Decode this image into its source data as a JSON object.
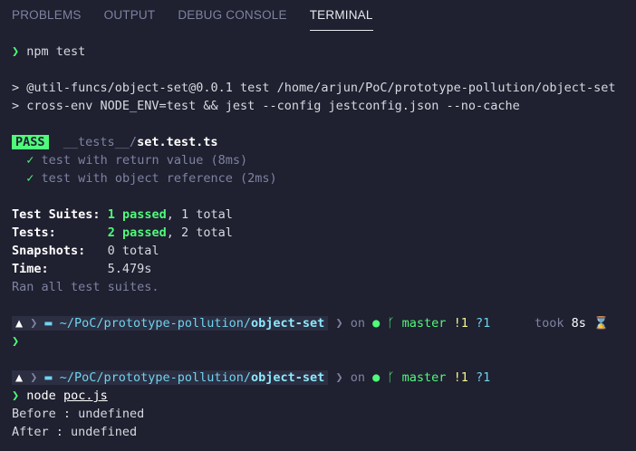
{
  "tabs": [
    "PROBLEMS",
    "OUTPUT",
    "DEBUG CONSOLE",
    "TERMINAL"
  ],
  "terminal": {
    "prompt_symbol": "❯",
    "cmd1": "npm test",
    "script_line1": "> @util-funcs/object-set@0.0.1 test /home/arjun/PoC/prototype-pollution/object-set",
    "script_line2": "> cross-env NODE_ENV=test && jest --config jestconfig.json --no-cache",
    "pass_badge": "PASS",
    "test_dir": "__tests__/",
    "test_file": "set.test.ts",
    "check": "✓",
    "test1": "test with return value (8ms)",
    "test2": "test with object reference (2ms)",
    "suites_label": "Test Suites:",
    "suites_passed": "1 passed",
    "suites_total": ", 1 total",
    "tests_label": "Tests:",
    "tests_passed": "2 passed",
    "tests_total": ", 2 total",
    "snap_label": "Snapshots:",
    "snap_value": "0 total",
    "time_label": "Time:",
    "time_value": "5.479s",
    "ran_all": "Ran all test suites.",
    "path_prefix": "~/PoC/prototype-pollution/",
    "path_dir": "object-set",
    "on_text": "on",
    "branch": "master",
    "git_modified": "!1",
    "git_untracked": "?1",
    "took_label": "took",
    "took_value": "8s",
    "cmd2_name": "node",
    "cmd2_arg": "poc.js",
    "out1": "Before : undefined",
    "out2": "After : undefined"
  }
}
